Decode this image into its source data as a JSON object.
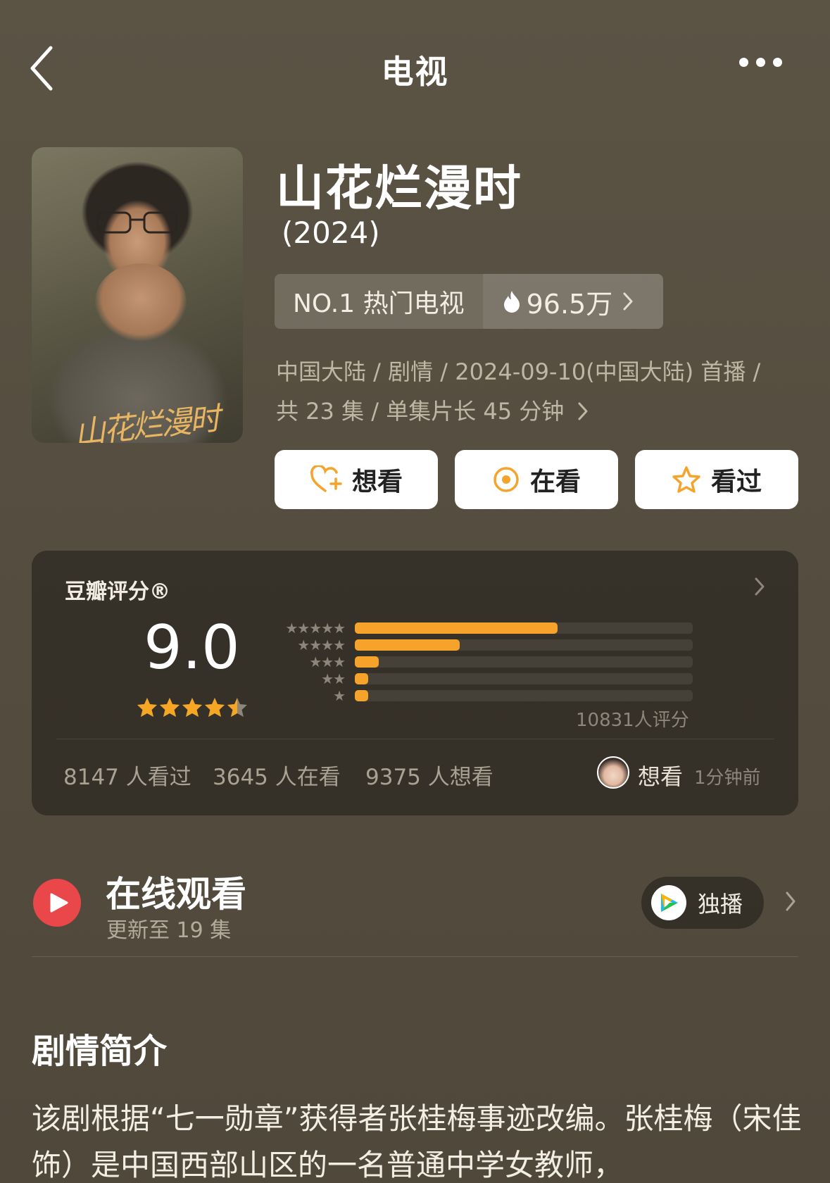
{
  "nav": {
    "title": "电视"
  },
  "poster": {
    "title_art": "山花烂漫时"
  },
  "show": {
    "title": "山花烂漫时",
    "year": "(2024)",
    "rank": "NO.1 热门电视",
    "heat": "96.5万",
    "meta_line1": "中国大陆 / 剧情 / 2024-09-10(中国大陆) 首播 /",
    "meta_line2": "共 23 集 / 单集片长 45 分钟"
  },
  "actions": {
    "want": "想看",
    "watching": "在看",
    "watched": "看过"
  },
  "rating": {
    "label": "豆瓣评分®",
    "score": "9.0",
    "stars": "★★★★★",
    "star_value": 4.5,
    "histogram": [
      {
        "stars": "★★★★★",
        "fraction": 0.6
      },
      {
        "stars": "★★★★",
        "fraction": 0.31
      },
      {
        "stars": "★★★",
        "fraction": 0.07
      },
      {
        "stars": "★★",
        "fraction": 0.04
      },
      {
        "stars": "★",
        "fraction": 0.04
      }
    ],
    "count": "10831人评分",
    "watched_count": "8147 人看过",
    "watching_count": "3645 人在看",
    "want_count": "9375 人想看",
    "activity_action": "想看",
    "activity_time": "1分钟前"
  },
  "online": {
    "title": "在线观看",
    "subtitle": "更新至 19 集",
    "badge": "独播"
  },
  "synopsis": {
    "title": "剧情简介",
    "text": "该剧根据“七一勋章”获得者张桂梅事迹改编。张桂梅（宋佳 饰）是中国西部山区的一名普通中学女教师，"
  },
  "colors": {
    "accent": "#f5a32a",
    "play": "#e9474a",
    "background": "#554d3f"
  }
}
